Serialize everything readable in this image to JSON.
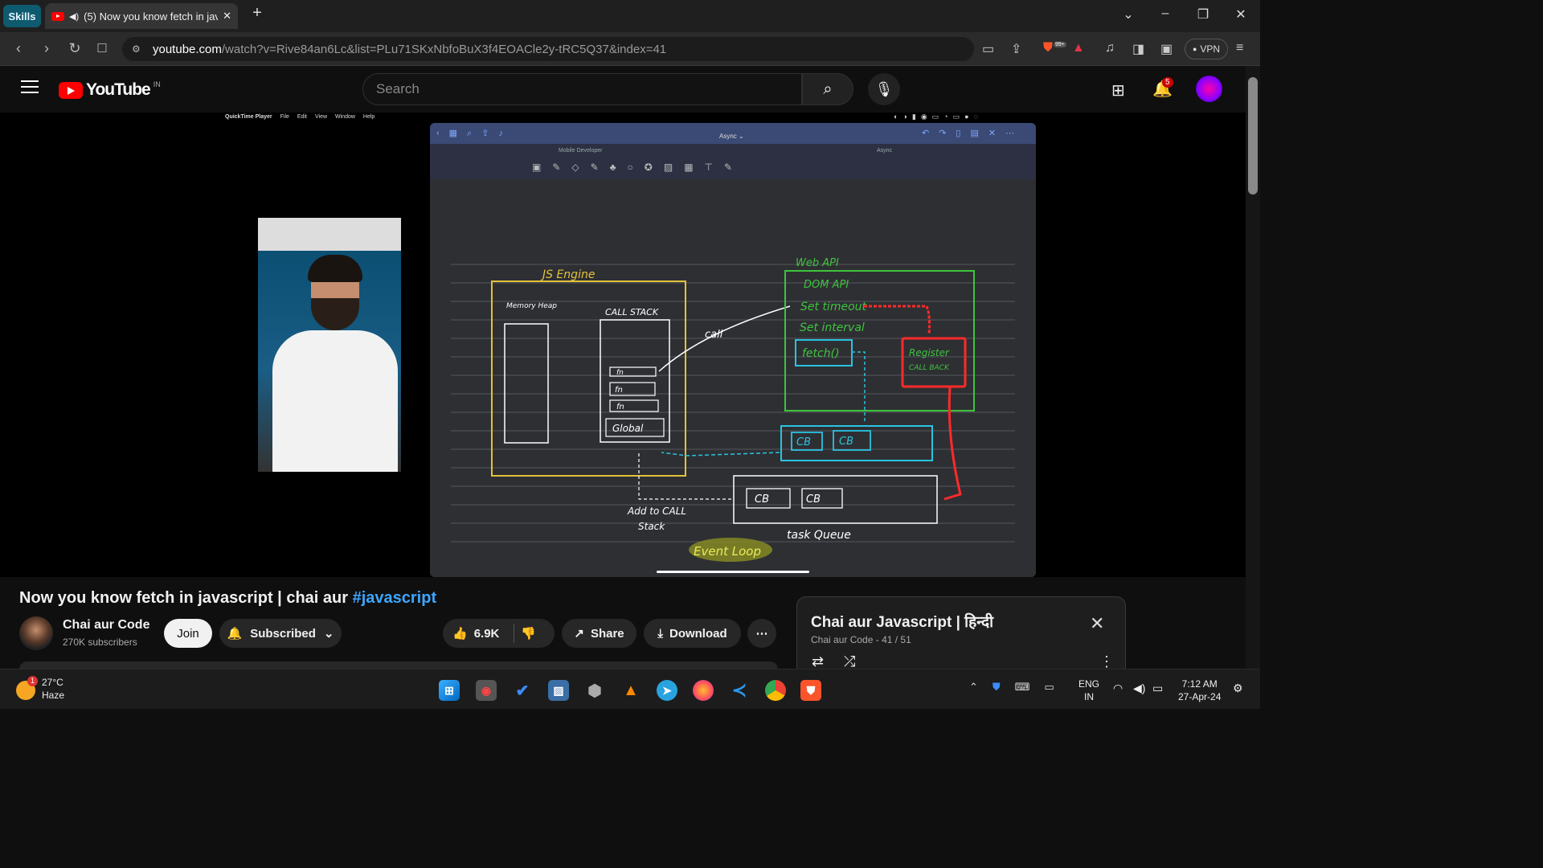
{
  "browser": {
    "skills_label": "Skills",
    "tab_title": "(5) Now you know fetch in javascript",
    "url_domain": "youtube.com",
    "url_path": "/watch?v=Rive84an6Lc&list=PLu71SKxNbfoBuX3f4EOACle2y-tRC5Q37&index=41",
    "vpn_label": "VPN",
    "brave_badge": "99+"
  },
  "youtube": {
    "logo_text": "YouTube",
    "country_code": "IN",
    "search_placeholder": "Search",
    "notification_count": "5"
  },
  "video_overlay": {
    "quicktime_menu": [
      "QuickTime Player",
      "File",
      "Edit",
      "View",
      "Window",
      "Help"
    ],
    "ipad_doc_title": "Async ⌄",
    "ipad_left_tab": "Mobile Developer",
    "ipad_right_tab": "Async",
    "whiteboard": {
      "js_engine": "JS Engine",
      "memory_heap": "Memory Heap",
      "call_stack": "CALL STACK",
      "stack_items": [
        "fn",
        "fn",
        "fn",
        "Global"
      ],
      "call_label": "call",
      "web_api": "Web API",
      "dom_api": "DOM API",
      "set_timeout": "Set timeout",
      "set_interval": "Set interval",
      "fetch": "fetch()",
      "register_callback_1": "Register",
      "register_callback_2": "CALL BACK",
      "cb": "CB",
      "add_to_call_stack_1": "Add to CALL",
      "add_to_call_stack_2": "Stack",
      "task_queue": "task Queue",
      "event_loop": "Event Loop"
    }
  },
  "video": {
    "title_text": "Now you know fetch in javascript | chai aur ",
    "title_hashtag": "#javascript",
    "channel_name": "Chai aur Code",
    "subscribers": "270K subscribers",
    "join_label": "Join",
    "subscribed_label": "Subscribed",
    "likes": "6.9K",
    "share_label": "Share",
    "download_label": "Download"
  },
  "playlist": {
    "title": "Chai aur Javascript | हिन्दी",
    "channel": "Chai aur Code",
    "position": "41 / 51"
  },
  "taskbar": {
    "temperature": "27°C",
    "weather": "Haze",
    "weather_alert": "1",
    "lang_1": "ENG",
    "lang_2": "IN",
    "time": "7:12 AM",
    "date": "27-Apr-24"
  }
}
